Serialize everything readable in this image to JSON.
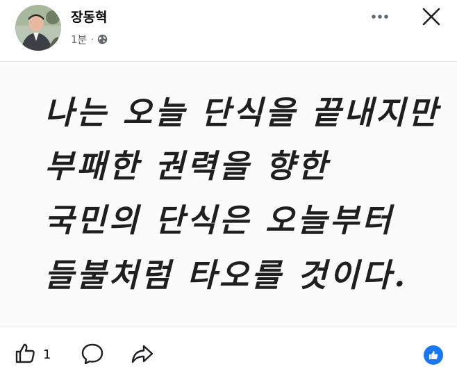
{
  "post": {
    "author": "장동혁",
    "time": "1분",
    "separator": "·",
    "privacy_icon": "globe-icon",
    "image_text_lines": [
      "나는 오늘 단식을 끝내지만",
      "부패한 권력을 향한",
      "국민의 단식은 오늘부터",
      "들불처럼 타오를 것이다."
    ]
  },
  "footer": {
    "like_count": "1",
    "like_icon": "thumbs-up-icon",
    "comment_icon": "comment-icon",
    "share_icon": "share-icon",
    "reaction_icon": "like-reaction-icon"
  },
  "colors": {
    "accent": "#1877f2",
    "muted_text": "#65676b",
    "divider": "#e4e6eb"
  }
}
